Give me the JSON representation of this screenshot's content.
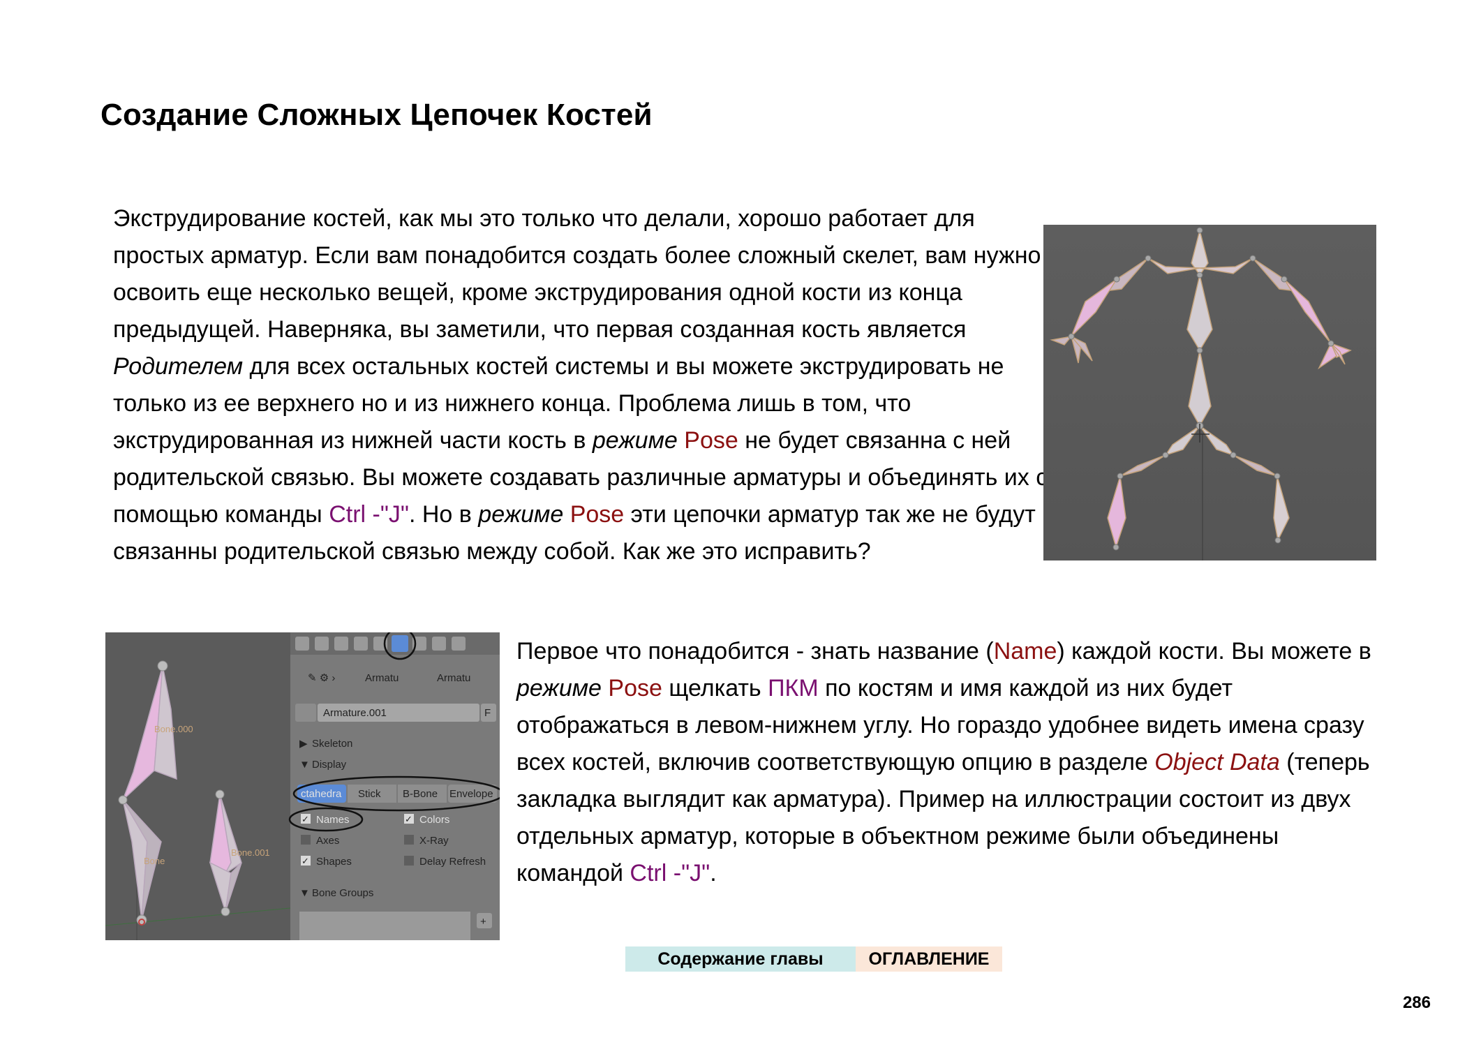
{
  "title": "Создание Сложных Цепочек Костей",
  "para1": {
    "t1": "Экструдирование костей, как мы это только что делали, хорошо работает для простых арматур. Если вам понадобится создать более сложный скелет, вам нужно освоить еще несколько вещей, кроме экструдирования одной кости из конца предыдущей. Наверняка, вы заметили, что первая созданная кость является ",
    "parent": "Родителем",
    "t2": " для всех остальных костей системы и вы можете экструдировать не только из ее верхнего но и из нижнего конца. Проблема лишь в том, что экструдированная из нижней части кость в ",
    "mode1": "режиме",
    "pose1": "Pose",
    "t3": " не будет связанна с ней родительской связью. Вы можете создавать различные арматуры и объединять их с помощью команды ",
    "ctrlj1": "Ctrl -\"J\"",
    "t4": ". Но в ",
    "mode2": "режиме",
    "pose2": "Pose",
    "t5": " эти цепочки арматур так же не будут связанны родительской связью между собой. Как же это исправить?"
  },
  "para2": {
    "t1": "Первое что понадобится - знать название (",
    "name": "Name",
    "t2": ") каждой кости. Вы можете в ",
    "mode": "режиме",
    "pose": "Pose",
    "t3": " щелкать ",
    "pkm": "ПКМ",
    "t4": " по костям и имя каждой из них будет отображаться в левом-нижнем углу. Но гораздо удобнее видеть имена сразу всех костей, включив соответствующую опцию в разделе ",
    "objdata": "Object Data",
    "t5": " (теперь закладка выглядит как арматура). Пример на иллюстрации состоит из двух отдельных арматур, которые в объектном режиме были объединены командой ",
    "ctrlj": "Ctrl -\"J\"",
    "t6": "."
  },
  "figure2": {
    "bone_label_1": "Bone.000",
    "bone_label_2": "Bone",
    "bone_label_3": "Bone.001",
    "crumb_1": "Armatu",
    "crumb_2": "Armatu",
    "datablock": "Armature.001",
    "fake_user": "F",
    "skeleton": "Skeleton",
    "display": "Display",
    "btn_octahedral": "ctahedra",
    "btn_stick": "Stick",
    "btn_bbone": "B-Bone",
    "btn_envelope": "Envelope",
    "chk_names": "Names",
    "chk_colors": "Colors",
    "chk_axes": "Axes",
    "chk_xray": "X-Ray",
    "chk_shapes": "Shapes",
    "chk_delay": "Delay Refresh",
    "bone_groups": "Bone Groups"
  },
  "nav": {
    "contents": "Содержание главы",
    "toc": "ОГЛАВЛЕНИЕ"
  },
  "page_number": "286"
}
